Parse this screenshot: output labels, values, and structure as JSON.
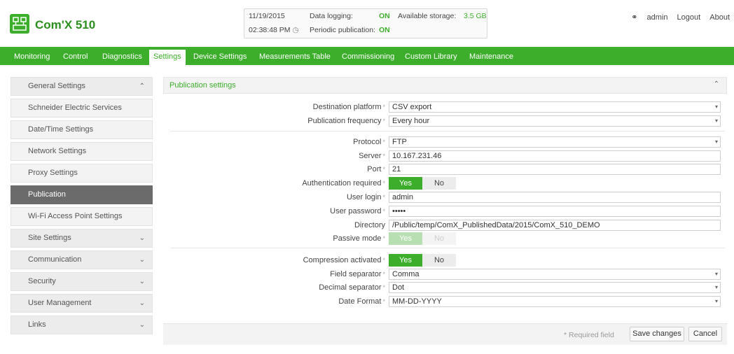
{
  "header": {
    "app_title": "Com'X 510",
    "date": "11/19/2015",
    "time": "02:38:48 PM",
    "data_logging_label": "Data logging:",
    "data_logging_value": "ON",
    "storage_label": "Available storage:",
    "storage_value": "3.5 GB",
    "periodic_label": "Periodic publication:",
    "periodic_value": "ON",
    "user": "admin",
    "logout": "Logout",
    "about": "About"
  },
  "nav": {
    "tabs": [
      "Monitoring",
      "Control",
      "Diagnostics",
      "Settings",
      "Device Settings",
      "Measurements Table",
      "Commissioning",
      "Custom Library",
      "Maintenance"
    ],
    "active": "Settings"
  },
  "sidebar": {
    "general_settings": "General Settings",
    "items": [
      "Schneider Electric Services",
      "Date/Time Settings",
      "Network Settings",
      "Proxy Settings",
      "Publication",
      "Wi-Fi Access Point Settings"
    ],
    "active_item": "Publication",
    "groups": [
      "Site Settings",
      "Communication",
      "Security",
      "User Management",
      "Links"
    ]
  },
  "section": {
    "title": "Publication settings"
  },
  "form": {
    "destination_platform": {
      "label": "Destination platform",
      "value": "CSV export"
    },
    "publication_frequency": {
      "label": "Publication frequency",
      "value": "Every hour"
    },
    "protocol": {
      "label": "Protocol",
      "value": "FTP"
    },
    "server": {
      "label": "Server",
      "value": "10.167.231.46"
    },
    "port": {
      "label": "Port",
      "value": "21"
    },
    "authentication_required": {
      "label": "Authentication required",
      "yes": "Yes",
      "no": "No"
    },
    "user_login": {
      "label": "User login",
      "value": "admin"
    },
    "user_password": {
      "label": "User password",
      "value": "•••••"
    },
    "directory": {
      "label": "Directory",
      "value": "/Public/temp/ComX_PublishedData/2015/ComX_510_DEMO"
    },
    "passive_mode": {
      "label": "Passive mode",
      "yes": "Yes",
      "no": "No"
    },
    "compression_activated": {
      "label": "Compression activated",
      "yes": "Yes",
      "no": "No"
    },
    "field_separator": {
      "label": "Field separator",
      "value": "Comma"
    },
    "decimal_separator": {
      "label": "Decimal separator",
      "value": "Dot"
    },
    "date_format": {
      "label": "Date Format",
      "value": "MM-DD-YYYY"
    },
    "required_mark": "*"
  },
  "footer": {
    "required_note": "Required field",
    "save": "Save changes",
    "cancel": "Cancel"
  },
  "colors": {
    "accent": "#3dae2b",
    "active_side": "#6b6b6b"
  }
}
